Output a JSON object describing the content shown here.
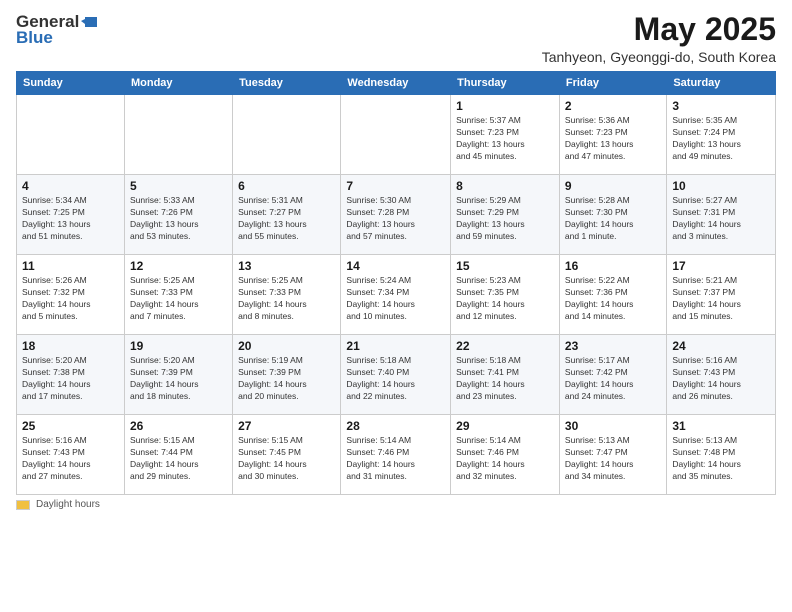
{
  "logo": {
    "line1": "General",
    "line2": "Blue"
  },
  "title": "May 2025",
  "subtitle": "Tanhyeon, Gyeonggi-do, South Korea",
  "days_of_week": [
    "Sunday",
    "Monday",
    "Tuesday",
    "Wednesday",
    "Thursday",
    "Friday",
    "Saturday"
  ],
  "footer": {
    "daylight_label": "Daylight hours"
  },
  "weeks": [
    [
      {
        "day": "",
        "info": ""
      },
      {
        "day": "",
        "info": ""
      },
      {
        "day": "",
        "info": ""
      },
      {
        "day": "",
        "info": ""
      },
      {
        "day": "1",
        "info": "Sunrise: 5:37 AM\nSunset: 7:23 PM\nDaylight: 13 hours\nand 45 minutes."
      },
      {
        "day": "2",
        "info": "Sunrise: 5:36 AM\nSunset: 7:23 PM\nDaylight: 13 hours\nand 47 minutes."
      },
      {
        "day": "3",
        "info": "Sunrise: 5:35 AM\nSunset: 7:24 PM\nDaylight: 13 hours\nand 49 minutes."
      }
    ],
    [
      {
        "day": "4",
        "info": "Sunrise: 5:34 AM\nSunset: 7:25 PM\nDaylight: 13 hours\nand 51 minutes."
      },
      {
        "day": "5",
        "info": "Sunrise: 5:33 AM\nSunset: 7:26 PM\nDaylight: 13 hours\nand 53 minutes."
      },
      {
        "day": "6",
        "info": "Sunrise: 5:31 AM\nSunset: 7:27 PM\nDaylight: 13 hours\nand 55 minutes."
      },
      {
        "day": "7",
        "info": "Sunrise: 5:30 AM\nSunset: 7:28 PM\nDaylight: 13 hours\nand 57 minutes."
      },
      {
        "day": "8",
        "info": "Sunrise: 5:29 AM\nSunset: 7:29 PM\nDaylight: 13 hours\nand 59 minutes."
      },
      {
        "day": "9",
        "info": "Sunrise: 5:28 AM\nSunset: 7:30 PM\nDaylight: 14 hours\nand 1 minute."
      },
      {
        "day": "10",
        "info": "Sunrise: 5:27 AM\nSunset: 7:31 PM\nDaylight: 14 hours\nand 3 minutes."
      }
    ],
    [
      {
        "day": "11",
        "info": "Sunrise: 5:26 AM\nSunset: 7:32 PM\nDaylight: 14 hours\nand 5 minutes."
      },
      {
        "day": "12",
        "info": "Sunrise: 5:25 AM\nSunset: 7:33 PM\nDaylight: 14 hours\nand 7 minutes."
      },
      {
        "day": "13",
        "info": "Sunrise: 5:25 AM\nSunset: 7:33 PM\nDaylight: 14 hours\nand 8 minutes."
      },
      {
        "day": "14",
        "info": "Sunrise: 5:24 AM\nSunset: 7:34 PM\nDaylight: 14 hours\nand 10 minutes."
      },
      {
        "day": "15",
        "info": "Sunrise: 5:23 AM\nSunset: 7:35 PM\nDaylight: 14 hours\nand 12 minutes."
      },
      {
        "day": "16",
        "info": "Sunrise: 5:22 AM\nSunset: 7:36 PM\nDaylight: 14 hours\nand 14 minutes."
      },
      {
        "day": "17",
        "info": "Sunrise: 5:21 AM\nSunset: 7:37 PM\nDaylight: 14 hours\nand 15 minutes."
      }
    ],
    [
      {
        "day": "18",
        "info": "Sunrise: 5:20 AM\nSunset: 7:38 PM\nDaylight: 14 hours\nand 17 minutes."
      },
      {
        "day": "19",
        "info": "Sunrise: 5:20 AM\nSunset: 7:39 PM\nDaylight: 14 hours\nand 18 minutes."
      },
      {
        "day": "20",
        "info": "Sunrise: 5:19 AM\nSunset: 7:39 PM\nDaylight: 14 hours\nand 20 minutes."
      },
      {
        "day": "21",
        "info": "Sunrise: 5:18 AM\nSunset: 7:40 PM\nDaylight: 14 hours\nand 22 minutes."
      },
      {
        "day": "22",
        "info": "Sunrise: 5:18 AM\nSunset: 7:41 PM\nDaylight: 14 hours\nand 23 minutes."
      },
      {
        "day": "23",
        "info": "Sunrise: 5:17 AM\nSunset: 7:42 PM\nDaylight: 14 hours\nand 24 minutes."
      },
      {
        "day": "24",
        "info": "Sunrise: 5:16 AM\nSunset: 7:43 PM\nDaylight: 14 hours\nand 26 minutes."
      }
    ],
    [
      {
        "day": "25",
        "info": "Sunrise: 5:16 AM\nSunset: 7:43 PM\nDaylight: 14 hours\nand 27 minutes."
      },
      {
        "day": "26",
        "info": "Sunrise: 5:15 AM\nSunset: 7:44 PM\nDaylight: 14 hours\nand 29 minutes."
      },
      {
        "day": "27",
        "info": "Sunrise: 5:15 AM\nSunset: 7:45 PM\nDaylight: 14 hours\nand 30 minutes."
      },
      {
        "day": "28",
        "info": "Sunrise: 5:14 AM\nSunset: 7:46 PM\nDaylight: 14 hours\nand 31 minutes."
      },
      {
        "day": "29",
        "info": "Sunrise: 5:14 AM\nSunset: 7:46 PM\nDaylight: 14 hours\nand 32 minutes."
      },
      {
        "day": "30",
        "info": "Sunrise: 5:13 AM\nSunset: 7:47 PM\nDaylight: 14 hours\nand 34 minutes."
      },
      {
        "day": "31",
        "info": "Sunrise: 5:13 AM\nSunset: 7:48 PM\nDaylight: 14 hours\nand 35 minutes."
      }
    ]
  ]
}
